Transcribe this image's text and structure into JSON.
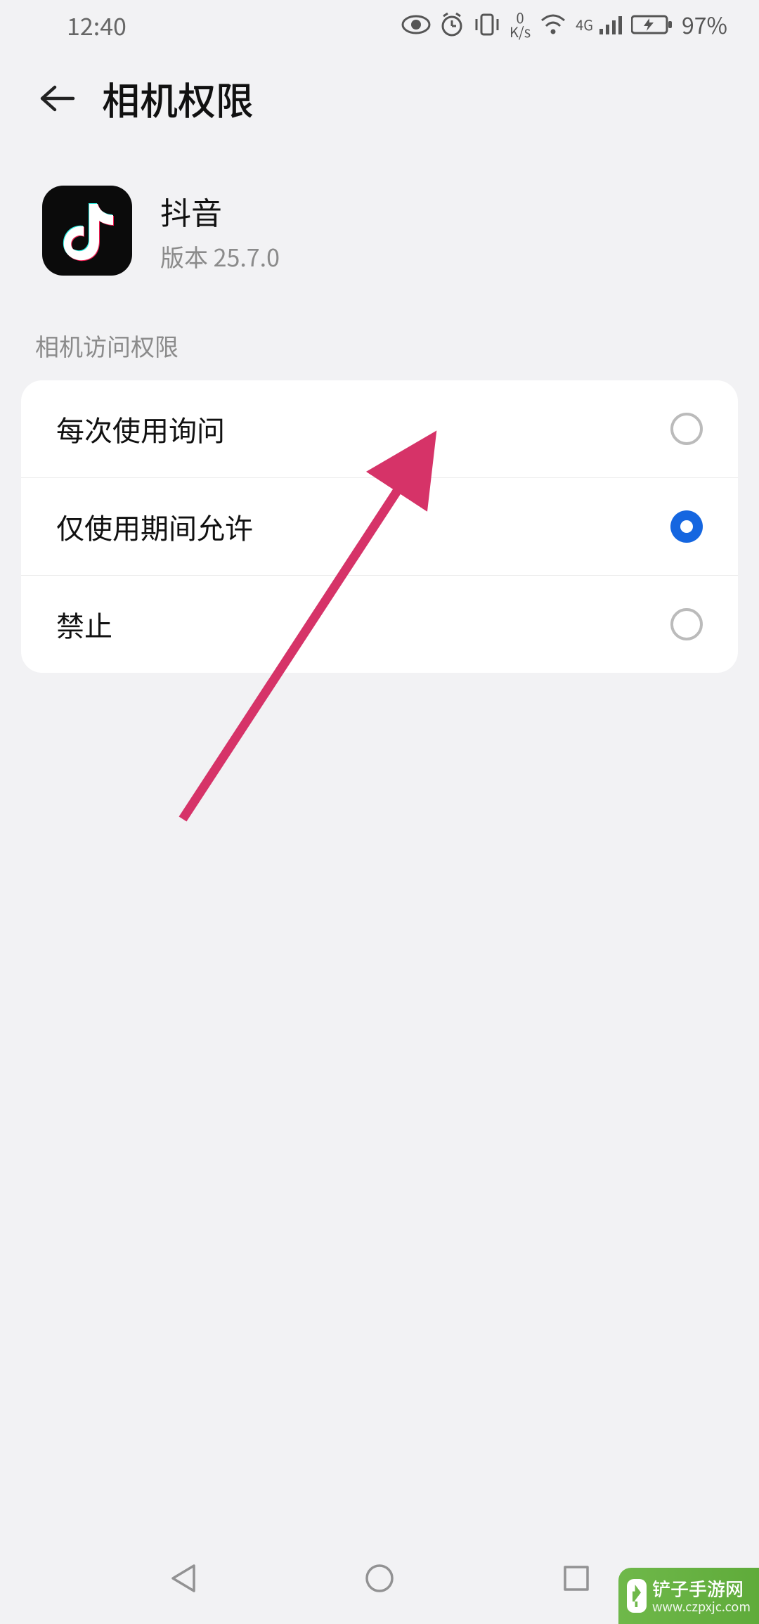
{
  "status": {
    "time": "12:40",
    "net_value": "0",
    "net_unit": "K/s",
    "signal_label": "4G",
    "battery": "97%"
  },
  "header": {
    "title": "相机权限"
  },
  "app": {
    "name": "抖音",
    "version": "版本 25.7.0"
  },
  "section": {
    "title": "相机访问权限"
  },
  "options": [
    {
      "label": "每次使用询问",
      "selected": false
    },
    {
      "label": "仅使用期间允许",
      "selected": true
    },
    {
      "label": "禁止",
      "selected": false
    }
  ],
  "watermark": {
    "name": "铲子手游网",
    "url": "www.czpxjc.com"
  }
}
